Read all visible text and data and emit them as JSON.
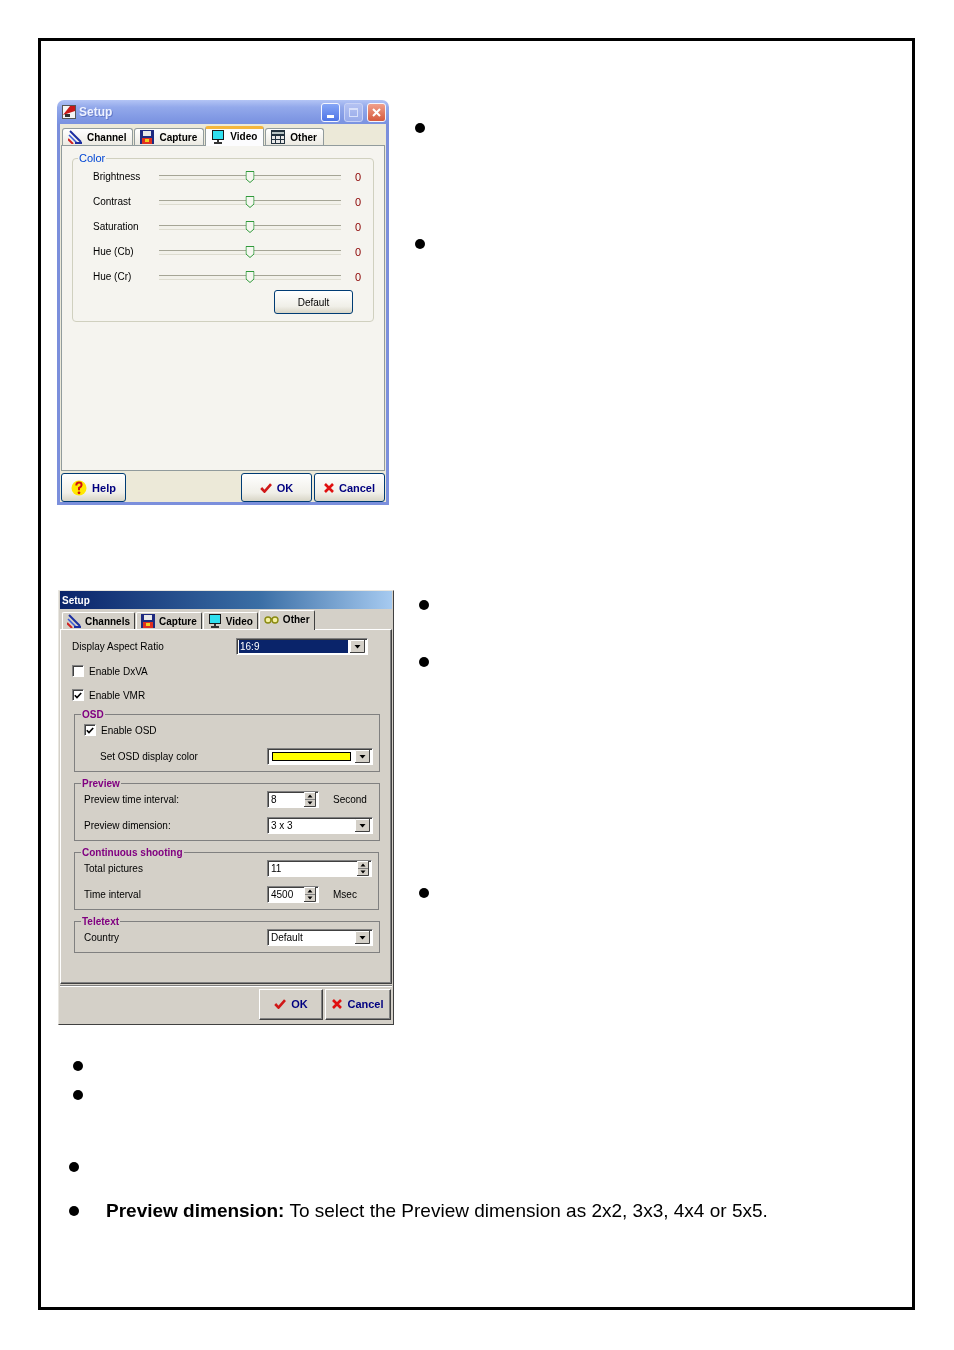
{
  "dialog_1": {
    "title": "Setup",
    "tabs": [
      {
        "label": "Channel",
        "selected": false
      },
      {
        "label": "Capture",
        "selected": false
      },
      {
        "label": "Video",
        "selected": true
      },
      {
        "label": "Other",
        "selected": false
      }
    ],
    "color_group": {
      "title": "Color",
      "sliders": [
        {
          "name": "Brightness",
          "level": 0.5,
          "reading": "0"
        },
        {
          "name": "Contrast",
          "level": 0.5,
          "reading": "0"
        },
        {
          "name": "Saturation",
          "level": 0.5,
          "reading": "0"
        },
        {
          "name": "Hue (Cb)",
          "level": 0.5,
          "reading": "0"
        },
        {
          "name": "Hue (Cr)",
          "level": 0.5,
          "reading": "0"
        }
      ],
      "default_button": "Default"
    },
    "buttons": [
      {
        "kind": "help",
        "label": "Help"
      },
      {
        "kind": "ok",
        "label": "OK"
      },
      {
        "kind": "cancel",
        "label": "Cancel"
      }
    ]
  },
  "dialog_2": {
    "title": "Setup",
    "tabs": [
      {
        "label": "Channels",
        "selected": false
      },
      {
        "label": "Capture",
        "selected": false
      },
      {
        "label": "Video",
        "selected": false
      },
      {
        "label": "Other",
        "selected": true
      }
    ],
    "items": [
      {
        "kind": "dropdown",
        "label": "Display Aspect Ratio",
        "value": "16:9",
        "focused": true
      },
      {
        "kind": "checkbox",
        "label": "Enable DxVA",
        "checked": false
      },
      {
        "kind": "checkbox",
        "label": "Enable VMR",
        "checked": true
      },
      {
        "kind": "group",
        "title": "OSD",
        "items": [
          {
            "kind": "checkbox",
            "label": "Enable OSD",
            "checked": true
          },
          {
            "kind": "color",
            "label": "Set OSD display color",
            "color": "#ffff00"
          }
        ]
      },
      {
        "kind": "group",
        "title": "Preview",
        "items": [
          {
            "kind": "spinner",
            "label": "Preview time interval:",
            "value": "8",
            "unit": "Second"
          },
          {
            "kind": "dropdown",
            "label": "Preview dimension:",
            "value": "3 x 3",
            "focused": false
          }
        ]
      },
      {
        "kind": "group",
        "title": "Continuous shooting",
        "items": [
          {
            "kind": "spinner",
            "label": "Total pictures",
            "value": "11"
          },
          {
            "kind": "spinner",
            "label": "Time interval",
            "value": "4500",
            "unit": "Msec"
          }
        ]
      },
      {
        "kind": "group",
        "title": "Teletext",
        "items": [
          {
            "kind": "dropdown",
            "label": "Country",
            "value": "Default",
            "focused": false
          }
        ]
      }
    ],
    "buttons": [
      {
        "kind": "ok",
        "label": "OK"
      },
      {
        "kind": "cancel",
        "label": "Cancel"
      }
    ]
  },
  "notes": [
    {
      "text": "**Preview dimension:** To select the Preview dimension as 2x2, 3x3, 4x4 or 5x5."
    }
  ]
}
